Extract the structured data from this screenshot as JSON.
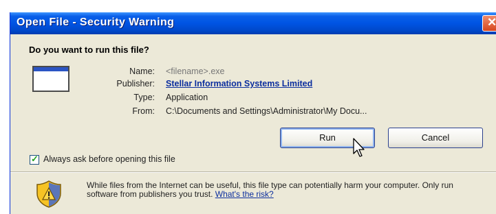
{
  "window": {
    "title": "Open File - Security Warning",
    "close_glyph": "✕"
  },
  "dialog": {
    "question": "Do you want to run this file?",
    "file_icon": "application-window-icon",
    "details": {
      "name_label": "Name:",
      "name_value": "<filename>.exe",
      "publisher_label": "Publisher:",
      "publisher_value": "Stellar Information Systems Limited",
      "type_label": "Type:",
      "type_value": "Application",
      "from_label": "From:",
      "from_value": "C:\\Documents and Settings\\Administrator\\My Docu..."
    },
    "buttons": {
      "run_label": "Run",
      "cancel_label": "Cancel"
    },
    "always_ask": {
      "checked": true,
      "label": "Always ask before opening this file"
    },
    "warning": {
      "icon": "security-shield-icon",
      "text": "While files from the Internet can be useful, this file type can potentially harm your computer. Only run software from publishers you trust.",
      "link_text": "What's the risk?"
    }
  },
  "colors": {
    "titlebar": "#0054e3",
    "dialog_bg": "#ece9d8",
    "link": "#0b2e9e"
  }
}
